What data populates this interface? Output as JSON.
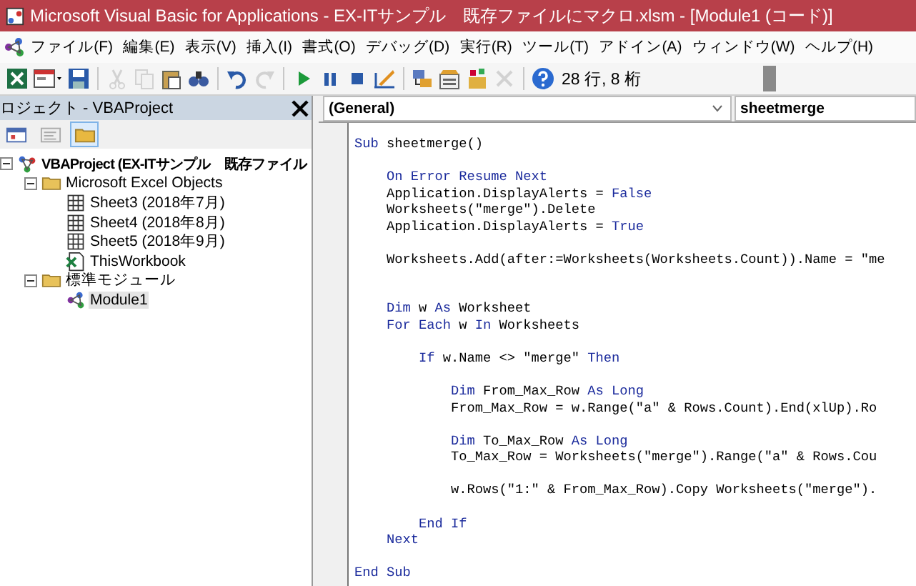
{
  "window": {
    "title": "Microsoft Visual Basic for Applications - EX-ITサンプル　既存ファイルにマクロ.xlsm - [Module1 (コード)]"
  },
  "menu": [
    "ファイル(F)",
    "編集(E)",
    "表示(V)",
    "挿入(I)",
    "書式(O)",
    "デバッグ(D)",
    "実行(R)",
    "ツール(T)",
    "アドイン(A)",
    "ウィンドウ(W)",
    "ヘルプ(H)"
  ],
  "toolbar": {
    "items": [
      {
        "kind": "excel",
        "disabled": false
      },
      {
        "kind": "insert-form",
        "disabled": false
      },
      {
        "kind": "save",
        "disabled": false
      },
      {
        "kind": "separator"
      },
      {
        "kind": "cut",
        "disabled": true
      },
      {
        "kind": "copy",
        "disabled": true
      },
      {
        "kind": "paste",
        "disabled": false
      },
      {
        "kind": "find",
        "disabled": false
      },
      {
        "kind": "separator"
      },
      {
        "kind": "undo",
        "disabled": false
      },
      {
        "kind": "redo",
        "disabled": true
      },
      {
        "kind": "separator"
      },
      {
        "kind": "run",
        "disabled": false
      },
      {
        "kind": "pause",
        "disabled": false
      },
      {
        "kind": "stop",
        "disabled": false
      },
      {
        "kind": "design",
        "disabled": false
      },
      {
        "kind": "separator"
      },
      {
        "kind": "project-explorer",
        "disabled": false
      },
      {
        "kind": "properties",
        "disabled": false
      },
      {
        "kind": "object-browser",
        "disabled": false
      },
      {
        "kind": "toolbox",
        "disabled": true
      },
      {
        "kind": "separator"
      },
      {
        "kind": "help",
        "disabled": false
      }
    ],
    "position": "28 行, 8 桁"
  },
  "project_panel": {
    "title": "ロジェクト - VBAProject",
    "buttons": [
      {
        "kind": "view-object",
        "selected": false
      },
      {
        "kind": "view-code",
        "selected": false
      },
      {
        "kind": "toggle-folders",
        "selected": true
      }
    ],
    "tree": [
      {
        "label": "VBAProject (EX-ITサンプル　既存ファイル",
        "kind": "project",
        "expanded": true,
        "selected": false,
        "children": [
          {
            "label": "Microsoft Excel Objects",
            "kind": "folder",
            "expanded": true,
            "selected": false,
            "children": [
              {
                "label": "Sheet3 (2018年7月)",
                "kind": "sheet",
                "selected": false
              },
              {
                "label": "Sheet4 (2018年8月)",
                "kind": "sheet",
                "selected": false
              },
              {
                "label": "Sheet5 (2018年9月)",
                "kind": "sheet",
                "selected": false
              },
              {
                "label": "ThisWorkbook",
                "kind": "workbook",
                "selected": false
              }
            ]
          },
          {
            "label": "標準モジュール",
            "kind": "folder",
            "expanded": true,
            "selected": false,
            "children": [
              {
                "label": "Module1",
                "kind": "module",
                "selected": true
              }
            ]
          }
        ]
      }
    ]
  },
  "code_window": {
    "object": "(General)",
    "procedure": "sheetmerge",
    "lines": [
      {
        "kind": "code",
        "segments": [
          {
            "text": "Sub",
            "kind": "keyword"
          },
          {
            "text": " sheetmerge()",
            "kind": "plain"
          }
        ]
      },
      {
        "kind": "blank"
      },
      {
        "kind": "code",
        "segments": [
          {
            "text": "    On Error Resume Next",
            "kind": "keyword"
          }
        ]
      },
      {
        "kind": "code",
        "segments": [
          {
            "text": "    Application.DisplayAlerts = ",
            "kind": "plain"
          },
          {
            "text": "False",
            "kind": "keyword"
          }
        ]
      },
      {
        "kind": "code",
        "segments": [
          {
            "text": "    Worksheets(\"merge\").Delete",
            "kind": "plain"
          }
        ]
      },
      {
        "kind": "code",
        "segments": [
          {
            "text": "    Application.DisplayAlerts = ",
            "kind": "plain"
          },
          {
            "text": "True",
            "kind": "keyword"
          }
        ]
      },
      {
        "kind": "blank"
      },
      {
        "kind": "code",
        "segments": [
          {
            "text": "    Worksheets.Add(after:=Worksheets(Worksheets.Count)).Name = \"me",
            "kind": "plain"
          }
        ]
      },
      {
        "kind": "blank"
      },
      {
        "kind": "blank"
      },
      {
        "kind": "code",
        "segments": [
          {
            "text": "    Dim",
            "kind": "keyword"
          },
          {
            "text": " w ",
            "kind": "plain"
          },
          {
            "text": "As",
            "kind": "keyword"
          },
          {
            "text": " Worksheet",
            "kind": "plain"
          }
        ]
      },
      {
        "kind": "code",
        "segments": [
          {
            "text": "    For Each",
            "kind": "keyword"
          },
          {
            "text": " w ",
            "kind": "plain"
          },
          {
            "text": "In",
            "kind": "keyword"
          },
          {
            "text": " Worksheets",
            "kind": "plain"
          }
        ]
      },
      {
        "kind": "blank"
      },
      {
        "kind": "code",
        "segments": [
          {
            "text": "        If",
            "kind": "keyword"
          },
          {
            "text": " w.Name <> \"merge\" ",
            "kind": "plain"
          },
          {
            "text": "Then",
            "kind": "keyword"
          }
        ]
      },
      {
        "kind": "blank"
      },
      {
        "kind": "code",
        "segments": [
          {
            "text": "            Dim",
            "kind": "keyword"
          },
          {
            "text": " From_Max_Row ",
            "kind": "plain"
          },
          {
            "text": "As Long",
            "kind": "keyword"
          }
        ]
      },
      {
        "kind": "code",
        "segments": [
          {
            "text": "            From_Max_Row = w.Range(\"a\" & Rows.Count).End(xlUp).Ro",
            "kind": "plain"
          }
        ]
      },
      {
        "kind": "blank"
      },
      {
        "kind": "code",
        "segments": [
          {
            "text": "            Dim",
            "kind": "keyword"
          },
          {
            "text": " To_Max_Row ",
            "kind": "plain"
          },
          {
            "text": "As Long",
            "kind": "keyword"
          }
        ]
      },
      {
        "kind": "code",
        "segments": [
          {
            "text": "            To_Max_Row = Worksheets(\"merge\").Range(\"a\" & Rows.Cou",
            "kind": "plain"
          }
        ]
      },
      {
        "kind": "blank"
      },
      {
        "kind": "code",
        "segments": [
          {
            "text": "            w.Rows(\"1:\" & From_Max_Row).Copy Worksheets(\"merge\").",
            "kind": "plain"
          }
        ]
      },
      {
        "kind": "blank"
      },
      {
        "kind": "code",
        "segments": [
          {
            "text": "        End If",
            "kind": "keyword"
          }
        ]
      },
      {
        "kind": "code",
        "segments": [
          {
            "text": "    Next",
            "kind": "keyword"
          }
        ]
      },
      {
        "kind": "blank"
      },
      {
        "kind": "code",
        "segments": [
          {
            "text": "End Sub",
            "kind": "keyword"
          }
        ]
      }
    ]
  }
}
